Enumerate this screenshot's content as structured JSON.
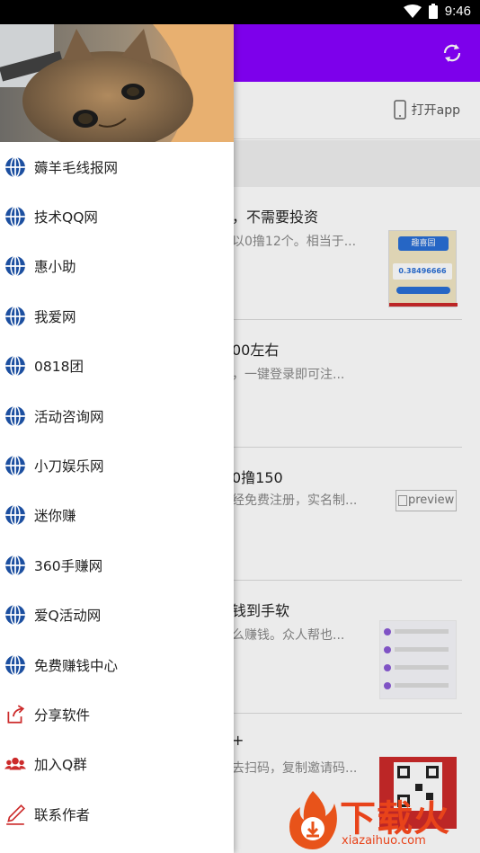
{
  "status_bar": {
    "time": "9:46"
  },
  "top_bar": {
    "open_app_label": "打开app"
  },
  "articles": [
    {
      "title": "，不需要投资",
      "desc": "以0撸12个。相当于...",
      "thumb_value": "0.38496666",
      "thumb_title": "趣喜园"
    },
    {
      "title": "00左右",
      "desc": "，一键登录即可注...",
      "thumb_value": "",
      "thumb_title": ""
    },
    {
      "title": "0撸150",
      "desc": "经免费注册，实名制...",
      "thumb_alt": "preview"
    },
    {
      "title": "钱到手软",
      "desc": "么赚钱。众人帮也...",
      "thumb_value": "",
      "thumb_title": ""
    },
    {
      "title": "+",
      "desc": "去扫码，复制邀请码..."
    }
  ],
  "drawer": {
    "items": [
      {
        "label": "薅羊毛线报网",
        "icon": "globe-icon"
      },
      {
        "label": "技术QQ网",
        "icon": "globe-icon"
      },
      {
        "label": "惠小助",
        "icon": "globe-icon"
      },
      {
        "label": "我爱网",
        "icon": "globe-icon"
      },
      {
        "label": "0818团",
        "icon": "globe-icon"
      },
      {
        "label": "活动咨询网",
        "icon": "globe-icon"
      },
      {
        "label": "小刀娱乐网",
        "icon": "globe-icon"
      },
      {
        "label": "迷你赚",
        "icon": "globe-icon"
      },
      {
        "label": "360手赚网",
        "icon": "globe-icon"
      },
      {
        "label": "爱Q活动网",
        "icon": "globe-icon"
      },
      {
        "label": "免费赚钱中心",
        "icon": "globe-icon"
      },
      {
        "label": "分享软件",
        "icon": "share-icon"
      },
      {
        "label": "加入Q群",
        "icon": "group-icon"
      },
      {
        "label": "联系作者",
        "icon": "pen-icon"
      }
    ]
  },
  "watermark": {
    "text": "下载火",
    "url": "xiazaihuo.com"
  },
  "colors": {
    "app_bar": "#8800ff",
    "globe_icon": "#1c4fa0",
    "accent_red": "#cc2a2a"
  }
}
